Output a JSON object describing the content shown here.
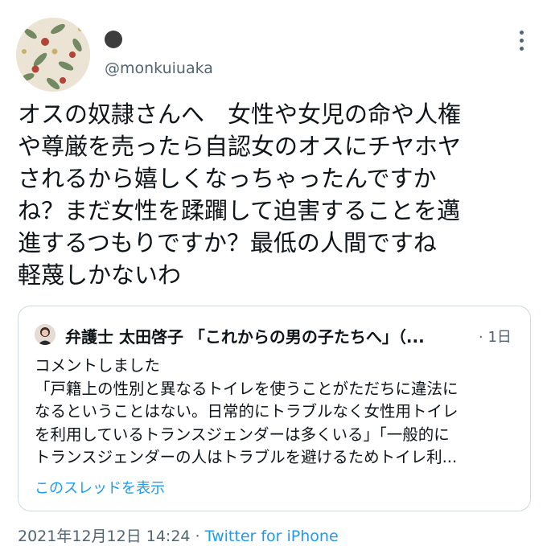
{
  "author": {
    "name_emoji": "🌚",
    "handle": "@monkuiuaka"
  },
  "tweet": {
    "lines": [
      "オスの奴隷さんへ　女性や女児の命や人権",
      "や尊厳を売ったら自認女のオスにチヤホヤ",
      "されるから嬉しくなっちゃったんですか",
      "ね？まだ女性を蹂躙して迫害することを邁",
      "進するつもりですか？最低の人間ですね",
      "軽蔑しかないわ"
    ]
  },
  "quoted": {
    "author": "弁護士 太田啓子 「これからの男の子たちへ」（...",
    "time": "· 1日",
    "lines": [
      "コメントしました",
      "「戸籍上の性別と異なるトイレを使うことがただちに違法に",
      "なるということはない。日常的にトラブルなく女性用トイレ",
      "を利用しているトランスジェンダーは多くいる」「一般的に",
      "トランスジェンダーの人はトラブルを避けるためトイレ利..."
    ],
    "thread_link": "このスレッドを表示"
  },
  "footer": {
    "timestamp": "2021年12月12日 14:24",
    "separator": " · ",
    "source": "Twitter for iPhone"
  },
  "colors": {
    "link": "#1d9bf0",
    "secondary_text": "#536471",
    "border": "#cfd9de"
  }
}
